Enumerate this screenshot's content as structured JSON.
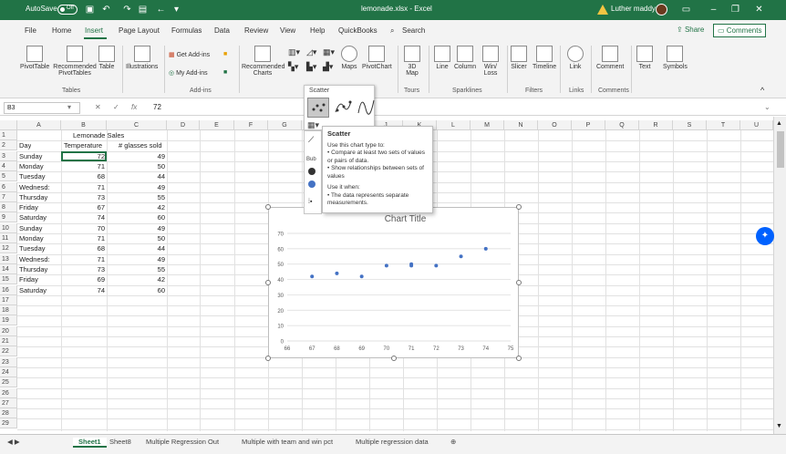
{
  "titlebar": {
    "autosave": "AutoSave",
    "toggle": "Off",
    "filename": "lemonade.xlsx - Excel",
    "user": "Luther maddy"
  },
  "menu": {
    "items": [
      "File",
      "Home",
      "Insert",
      "Page Layout",
      "Formulas",
      "Data",
      "Review",
      "View",
      "Help",
      "QuickBooks"
    ],
    "search": "Search",
    "share": "Share",
    "comments": "Comments"
  },
  "ribbon": {
    "pivottable": "PivotTable",
    "recommended_pivot": "Recommended PivotTables",
    "table": "Table",
    "illustrations": "Illustrations",
    "get_addins": "Get Add-ins",
    "my_addins": "My Add-ins",
    "recommended_charts": "Recommended Charts",
    "maps": "Maps",
    "pivotchart": "PivotChart",
    "map3d": "3D Map",
    "line": "Line",
    "column": "Column",
    "winloss": "Win/ Loss",
    "slicer": "Slicer",
    "timeline": "Timeline",
    "link": "Link",
    "comment": "Comment",
    "text": "Text",
    "symbols": "Symbols",
    "groups": [
      "Tables",
      "Add-ins",
      "Tours",
      "Sparklines",
      "Filters",
      "Links",
      "Comments"
    ]
  },
  "formula_bar": {
    "namebox": "B3",
    "fx": "fx",
    "value": "72"
  },
  "columns": [
    "A",
    "B",
    "C",
    "D",
    "E",
    "F",
    "G",
    "H",
    "I",
    "J",
    "K",
    "L",
    "M",
    "N",
    "O",
    "P",
    "Q",
    "R",
    "S",
    "T",
    "U"
  ],
  "rows": [
    "1",
    "2",
    "3",
    "4",
    "5",
    "6",
    "7",
    "8",
    "9",
    "10",
    "11",
    "12",
    "13",
    "14",
    "15",
    "16",
    "17",
    "18",
    "19",
    "20",
    "21",
    "22",
    "23",
    "24",
    "25",
    "26",
    "27",
    "28",
    "29"
  ],
  "table": {
    "title": "Lemonade Sales",
    "headers": [
      "Day",
      "Temperature",
      "# glasses sold"
    ],
    "data": [
      [
        "Sunday",
        "72",
        "49"
      ],
      [
        "Monday",
        "71",
        "50"
      ],
      [
        "Tuesday",
        "68",
        "44"
      ],
      [
        "Wednesd:",
        "71",
        "49"
      ],
      [
        "Thursday",
        "73",
        "55"
      ],
      [
        "Friday",
        "67",
        "42"
      ],
      [
        "Saturday",
        "74",
        "60"
      ],
      [
        "Sunday",
        "70",
        "49"
      ],
      [
        "Monday",
        "71",
        "50"
      ],
      [
        "Tuesday",
        "68",
        "44"
      ],
      [
        "Wednesd:",
        "71",
        "49"
      ],
      [
        "Thursday",
        "73",
        "55"
      ],
      [
        "Friday",
        "69",
        "42"
      ],
      [
        "Saturday",
        "74",
        "60"
      ]
    ]
  },
  "chart_data": {
    "type": "scatter",
    "title": "Chart Title",
    "xlim": [
      66,
      75
    ],
    "ylim": [
      0,
      70
    ],
    "xticks": [
      "66",
      "67",
      "68",
      "69",
      "70",
      "71",
      "72",
      "73",
      "74",
      "75"
    ],
    "yticks": [
      "0",
      "10",
      "20",
      "30",
      "40",
      "50",
      "60",
      "70"
    ],
    "x": [
      67,
      68,
      69,
      70,
      71,
      71,
      72,
      73,
      74
    ],
    "y": [
      42,
      44,
      42,
      49,
      49,
      50,
      49,
      55,
      60
    ],
    "color": "#4472c4"
  },
  "scatter_menu": {
    "label": "Scatter",
    "bubble": "Bub"
  },
  "tooltip": {
    "title": "Scatter",
    "line1": "Use this chart type to:",
    "line2": "• Compare at least two sets of values or pairs of data.",
    "line3": "• Show relationships between sets of values",
    "line4": "Use it when:",
    "line5": "• The data represents separate measurements."
  },
  "sheet_tabs": {
    "active": "Sheet1",
    "others": [
      "Sheet8",
      "Multiple Regression Out",
      "Multiple with team and win pct",
      "Multiple regression data"
    ]
  }
}
